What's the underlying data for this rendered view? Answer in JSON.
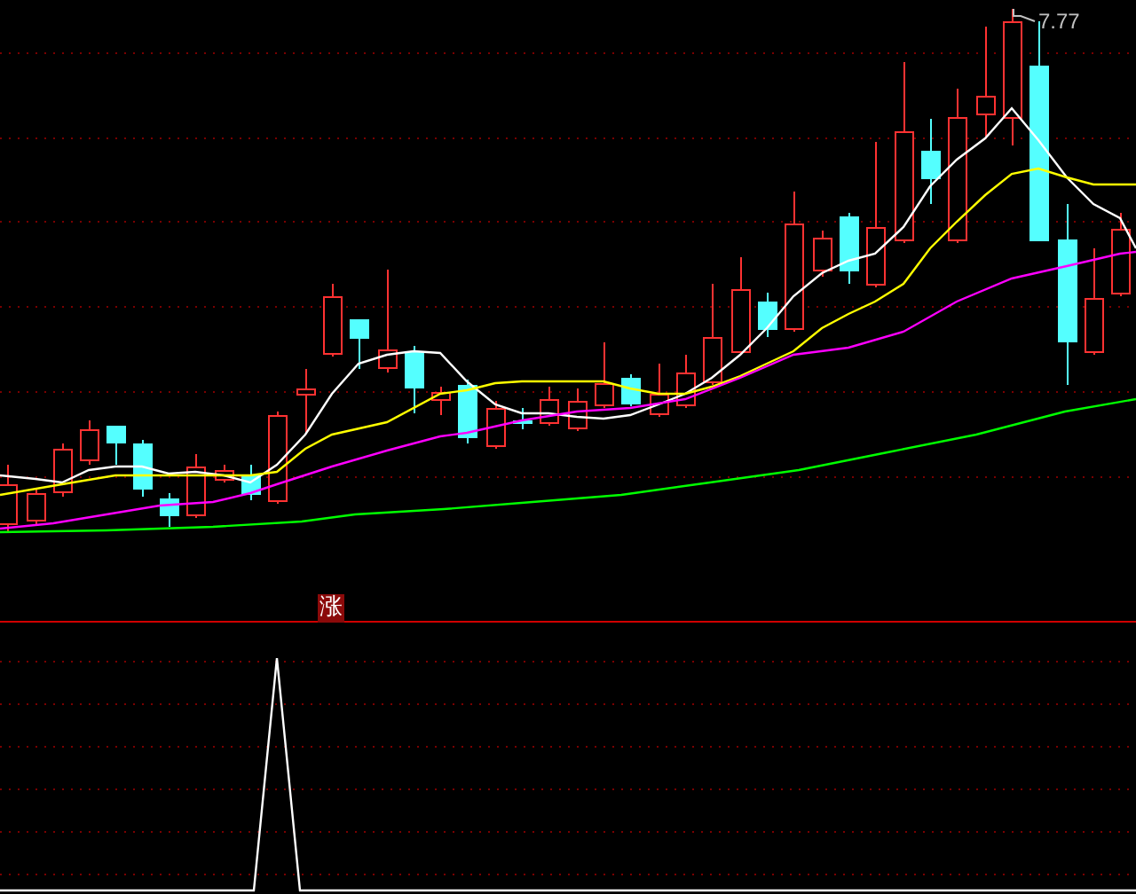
{
  "price_chart": {
    "high_label": "7.77"
  },
  "signal_panel": {
    "signal_label": "涨"
  }
}
